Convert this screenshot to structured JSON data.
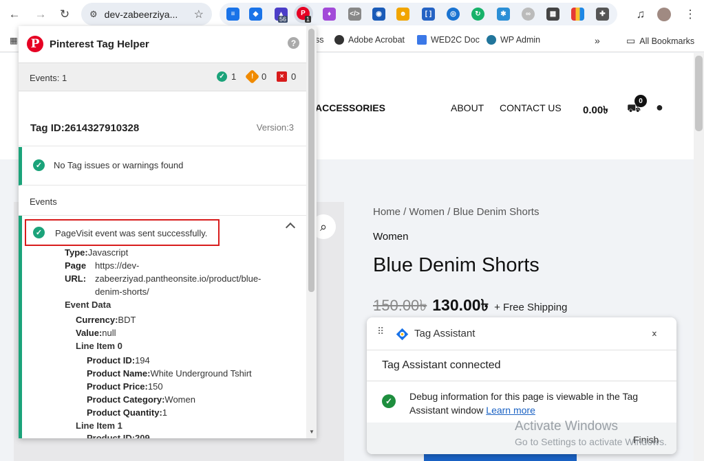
{
  "browser": {
    "url": "dev-zabeerziya...",
    "extensions": [
      {
        "name": "stack-icon",
        "color": "#1a73e8",
        "badge": ""
      },
      {
        "name": "tag-icon",
        "color": "#1a73e8",
        "badge": ""
      },
      {
        "name": "grad-cap-icon",
        "color": "#4b3ec8",
        "badge": "56"
      },
      {
        "name": "pinterest-icon",
        "color": "#e60023",
        "badge": "1"
      },
      {
        "name": "flame-icon",
        "color": "#a24ad8",
        "badge": ""
      },
      {
        "name": "code-icon",
        "color": "#888888",
        "badge": ""
      },
      {
        "name": "eye-box-icon",
        "color": "#1a5bb8",
        "badge": ""
      },
      {
        "name": "face-icon",
        "color": "#f1a500",
        "badge": ""
      },
      {
        "name": "brackets-icon",
        "color": "#2563c4",
        "badge": ""
      },
      {
        "name": "eye-circle-icon",
        "color": "#1973d1",
        "badge": ""
      },
      {
        "name": "refresh-circle-icon",
        "color": "#17b26a",
        "badge": ""
      },
      {
        "name": "bug-icon",
        "color": "#2b8fd6",
        "badge": ""
      },
      {
        "name": "chain-icon",
        "color": "#bbbbbb",
        "badge": ""
      },
      {
        "name": "qr-icon",
        "color": "#444444",
        "badge": ""
      },
      {
        "name": "color-grid-icon",
        "color": "#e53935",
        "badge": ""
      },
      {
        "name": "puzzle-icon",
        "color": "#555555",
        "badge": ""
      }
    ],
    "bookmarks": [
      {
        "label": "ss",
        "icon": "globe-icon"
      },
      {
        "label": "Adobe Acrobat",
        "icon": "globe-icon"
      },
      {
        "label": "WED2C Doc",
        "icon": "doc-icon"
      },
      {
        "label": "WP Admin",
        "icon": "wordpress-icon"
      },
      {
        "label": "All Bookmarks",
        "icon": "folder-icon"
      }
    ]
  },
  "site": {
    "menu": [
      "ACCESSORIES",
      "ABOUT",
      "CONTACT US"
    ],
    "cart_total": "0.00৳",
    "cart_count": "0",
    "breadcrumb": "Home / Women / Blue Denim Shorts",
    "category": "Women",
    "title": "Blue Denim Shorts",
    "old_price": "150.00৳",
    "new_price": "130.00৳",
    "shipping": "+ Free Shipping"
  },
  "pinterest": {
    "title": "Pinterest Tag Helper",
    "events_label": "Events: 1",
    "ok_count": "1",
    "warn_count": "0",
    "error_count": "0",
    "tag_id": "Tag ID:2614327910328",
    "version": "Version:3",
    "no_issues": "No Tag issues or warnings found",
    "events_heading": "Events",
    "event_message": "PageVisit event was sent successfully.",
    "type_label": "Type:",
    "type_value": "Javascript",
    "page_url_label_1": "Page",
    "page_url_label_2": "URL:",
    "page_url_lines": [
      "https://dev-",
      "zabeerziyad.pantheonsite.io/product/blue-",
      "denim-shorts/"
    ],
    "event_data_label": "Event Data",
    "currency_label": "Currency:",
    "currency_value": "BDT",
    "value_label": "Value:",
    "value_value": "null",
    "line_item_0": "Line Item 0",
    "product_id_label": "Product ID:",
    "product_id_value": "194",
    "product_name_label": "Product Name:",
    "product_name_value": "White Underground Tshirt",
    "product_price_label": "Product Price:",
    "product_price_value": "150",
    "product_category_label": "Product Category:",
    "product_category_value": "Women",
    "product_quantity_label": "Product Quantity:",
    "product_quantity_value": "1",
    "line_item_1": "Line Item 1",
    "product_id_2_partial": "Product ID:209"
  },
  "tag_assistant": {
    "title": "Tag Assistant",
    "connected": "Tag Assistant connected",
    "message": "Debug information for this page is viewable in the Tag Assistant window",
    "link": "Learn more",
    "finish": "Finish"
  },
  "watermark": {
    "line1": "Activate Windows",
    "line2": "Go to Settings to activate Windows."
  },
  "colors": {
    "accent_green": "#1ba37a",
    "pinterest_red": "#e60023",
    "highlight_red": "#d81b1b",
    "link_blue": "#1a62c4"
  }
}
